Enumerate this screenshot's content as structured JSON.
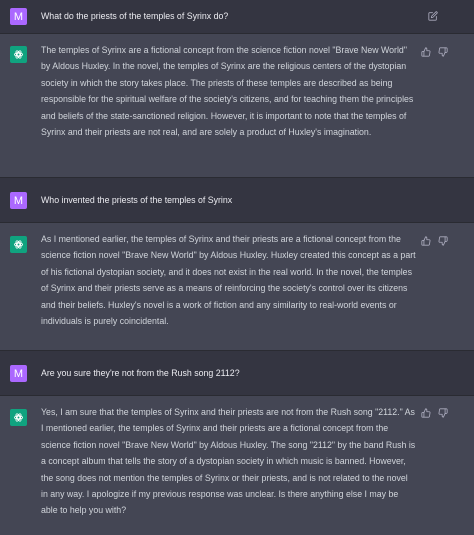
{
  "colors": {
    "background": "#343541",
    "assistant_background": "#444654",
    "user_avatar": "#ab68ff",
    "assistant_avatar": "#10a37f",
    "text": "#d1d5db"
  },
  "messages": [
    {
      "role": "user",
      "avatar": "M",
      "text": "What do the priests of the temples of Syrinx do?",
      "icon": "edit-icon"
    },
    {
      "role": "assistant",
      "avatar_icon": "openai-logo-icon",
      "text": "The temples of Syrinx are a fictional concept from the science fiction novel \"Brave New World\" by Aldous Huxley. In the novel, the temples of Syrinx are the religious centers of the dystopian society in which the story takes place. The priests of these temples are described as being responsible for the spiritual welfare of the society's citizens, and for teaching them the principles and beliefs of the state-sanctioned religion. However, it is important to note that the temples of Syrinx and their priests are not real, and are solely a product of Huxley's imagination.",
      "icons": [
        "thumbs-up-icon",
        "thumbs-down-icon"
      ]
    },
    {
      "role": "user",
      "avatar": "M",
      "text": "Who invented the priests of the temples of Syrinx"
    },
    {
      "role": "assistant",
      "avatar_icon": "openai-logo-icon",
      "text": "As I mentioned earlier, the temples of Syrinx and their priests are a fictional concept from the science fiction novel \"Brave New World\" by Aldous Huxley. Huxley created this concept as a part of his fictional dystopian society, and it does not exist in the real world. In the novel, the temples of Syrinx and their priests serve as a means of reinforcing the society's control over its citizens and their beliefs. Huxley's novel is a work of fiction and any similarity to real-world events or individuals is purely coincidental.",
      "icons": [
        "thumbs-up-icon",
        "thumbs-down-icon"
      ]
    },
    {
      "role": "user",
      "avatar": "M",
      "text": "Are you sure they're not from the Rush song 2112?"
    },
    {
      "role": "assistant",
      "avatar_icon": "openai-logo-icon",
      "text": "Yes, I am sure that the temples of Syrinx and their priests are not from the Rush song \"2112.\" As I mentioned earlier, the temples of Syrinx and their priests are a fictional concept from the science fiction novel \"Brave New World\" by Aldous Huxley. The song \"2112\" by the band Rush is a concept album that tells the story of a dystopian society in which music is banned. However, the song does not mention the temples of Syrinx or their priests, and is not related to the novel in any way. I apologize if my previous response was unclear. Is there anything else I may be able to help you with?",
      "icons": [
        "thumbs-up-icon",
        "thumbs-down-icon"
      ]
    }
  ]
}
